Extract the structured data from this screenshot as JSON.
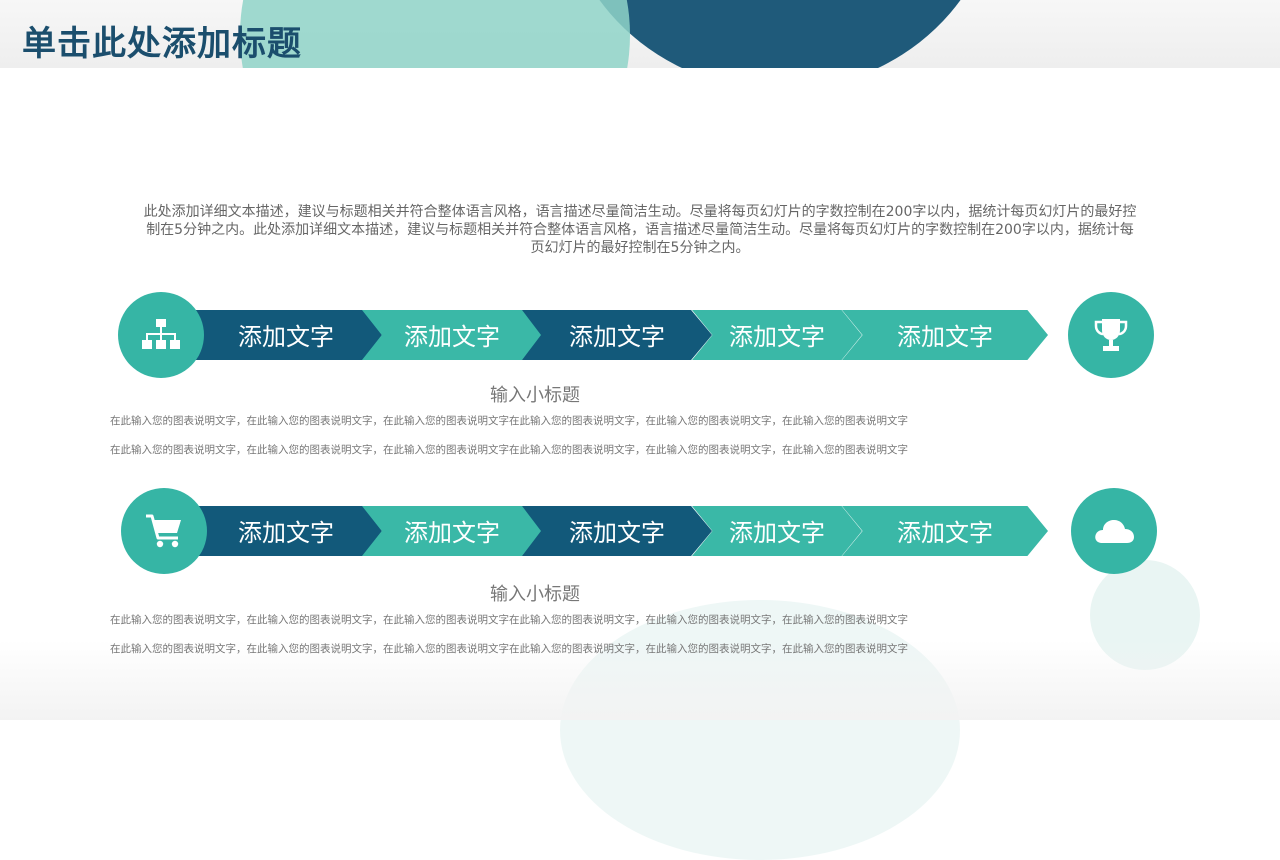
{
  "header": {
    "title": "单击此处添加标题"
  },
  "intro_text": "此处添加详细文本描述，建议与标题相关并符合整体语言风格，语言描述尽量简洁生动。尽量将每页幻灯片的字数控制在200字以内，据统计每页幻灯片的最好控制在5分钟之内。此处添加详细文本描述，建议与标题相关并符合整体语言风格，语言描述尽量简洁生动。尽量将每页幻灯片的字数控制在200字以内，据统计每页幻灯片的最好控制在5分钟之内。",
  "rows": [
    {
      "left_icon": "hierarchy-icon",
      "right_icon": "trophy-icon",
      "steps": [
        "添加文字",
        "添加文字",
        "添加文字",
        "添加文字",
        "添加文字"
      ],
      "subtitle": "输入小标题",
      "desc_lines": [
        "在此输入您的图表说明文字，在此输入您的图表说明文字，在此输入您的图表说明文字在此输入您的图表说明文字，在此输入您的图表说明文字，在此输入您的图表说明文字",
        "在此输入您的图表说明文字，在此输入您的图表说明文字，在此输入您的图表说明文字在此输入您的图表说明文字，在此输入您的图表说明文字，在此输入您的图表说明文字"
      ]
    },
    {
      "left_icon": "shopping-cart-icon",
      "right_icon": "cloud-icon",
      "steps": [
        "添加文字",
        "添加文字",
        "添加文字",
        "添加文字",
        "添加文字"
      ],
      "subtitle": "输入小标题",
      "desc_lines": [
        "在此输入您的图表说明文字，在此输入您的图表说明文字，在此输入您的图表说明文字在此输入您的图表说明文字，在此输入您的图表说明文字，在此输入您的图表说明文字",
        "在此输入您的图表说明文字，在此输入您的图表说明文字，在此输入您的图表说明文字在此输入您的图表说明文字，在此输入您的图表说明文字，在此输入您的图表说明文字"
      ]
    }
  ],
  "colors": {
    "navy": "#12597a",
    "teal": "#3ab8a7",
    "circle": "#36b5a5",
    "title": "#1b4e6d"
  }
}
